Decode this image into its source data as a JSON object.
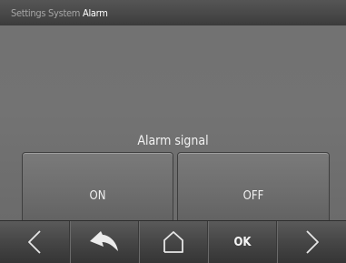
{
  "breadcrumb": {
    "settings": "Settings",
    "system": "System",
    "alarm": "Alarm"
  },
  "screen": {
    "title": "Alarm signal"
  },
  "buttons": {
    "on": "ON",
    "off": "OFF"
  },
  "nav": {
    "left_icon": "arrow-left-icon",
    "back_icon": "return-arrow-icon",
    "home_icon": "home-icon",
    "ok": "OK",
    "right_icon": "arrow-right-icon"
  },
  "colors": {
    "background": "#727272",
    "text": "#f2f2f2",
    "bar": "#444444"
  }
}
